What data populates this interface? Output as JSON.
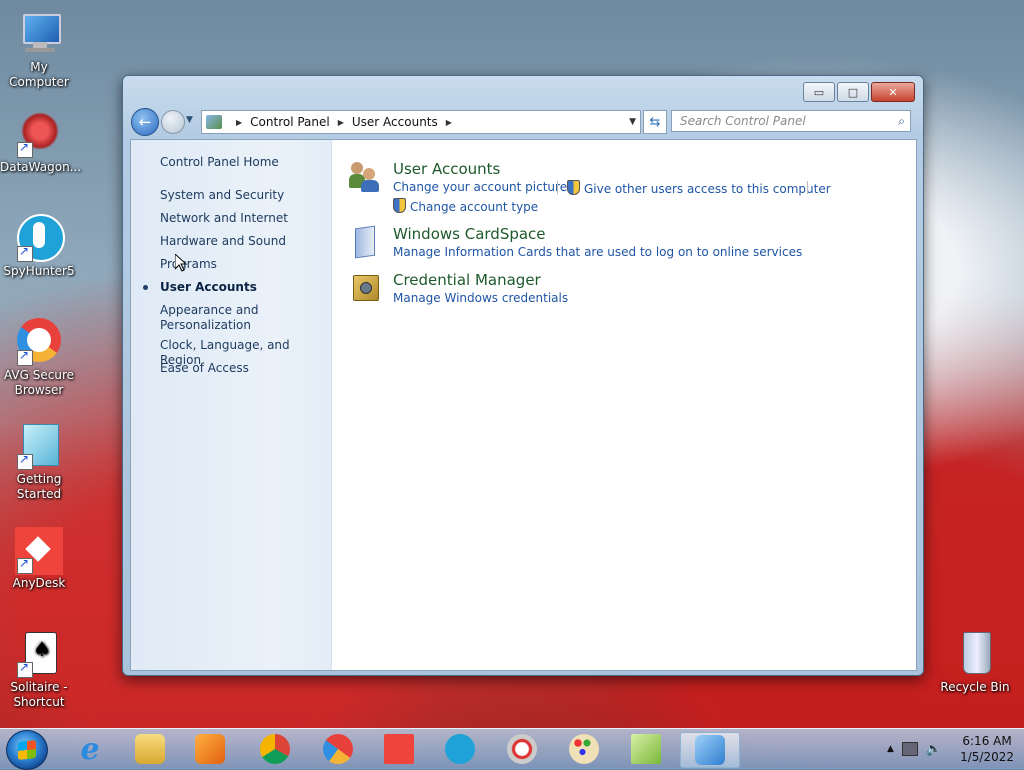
{
  "desktop": {
    "icons": [
      {
        "label": "My Computer"
      },
      {
        "label": "DataWagon..."
      },
      {
        "label": "SpyHunter5"
      },
      {
        "label": "AVG Secure Browser"
      },
      {
        "label": "Getting Started"
      },
      {
        "label": "AnyDesk"
      },
      {
        "label": "Solitaire - Shortcut"
      },
      {
        "label": "Recycle Bin"
      }
    ]
  },
  "window": {
    "controls": {
      "minimize": "▭",
      "maximize": "□",
      "close": "✕"
    },
    "address": {
      "crumbs": [
        "Control Panel",
        "User Accounts"
      ]
    },
    "search": {
      "placeholder": "Search Control Panel"
    },
    "nav": {
      "home": "Control Panel Home",
      "items": [
        "System and Security",
        "Network and Internet",
        "Hardware and Sound",
        "Programs",
        "User Accounts",
        "Appearance and Personalization",
        "Clock, Language, and Region",
        "Ease of Access"
      ]
    },
    "sections": {
      "user_accounts": {
        "title": "User Accounts",
        "links": [
          "Change your account picture",
          "Give other users access to this computer",
          "Change account type"
        ]
      },
      "cardspace": {
        "title": "Windows CardSpace",
        "links": [
          "Manage Information Cards that are used to log on to online services"
        ]
      },
      "credential": {
        "title": "Credential Manager",
        "links": [
          "Manage Windows credentials"
        ]
      }
    }
  },
  "taskbar": {
    "clock": {
      "time": "6:16 AM",
      "date": "1/5/2022"
    }
  }
}
